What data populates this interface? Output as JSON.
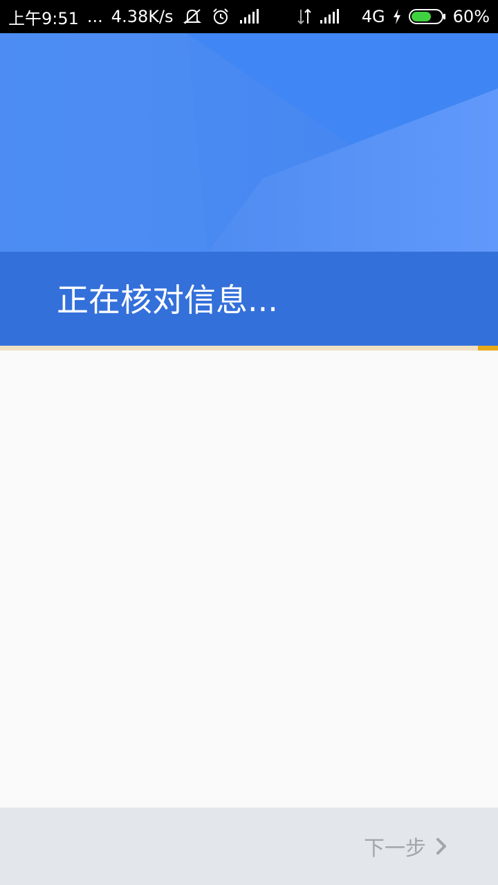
{
  "status_bar": {
    "time": "上午9:51",
    "dots": "...",
    "speed": "4.38K/s",
    "network": "4G",
    "battery": "60%",
    "icons": [
      "mute-icon",
      "alarm-icon",
      "signal-icon",
      "data-arrows-icon",
      "signal-icon",
      "charging-icon",
      "battery-icon"
    ]
  },
  "header": {
    "title": "正在核对信息..."
  },
  "progress": {
    "value": 0.04
  },
  "footer": {
    "next_label": "下一步",
    "next_icon": "chevron-right-icon"
  },
  "colors": {
    "header_blue": "#4a89ef",
    "title_band": "#3470da",
    "progress": "#e8aa1a",
    "next_text": "#a2a6ab"
  }
}
